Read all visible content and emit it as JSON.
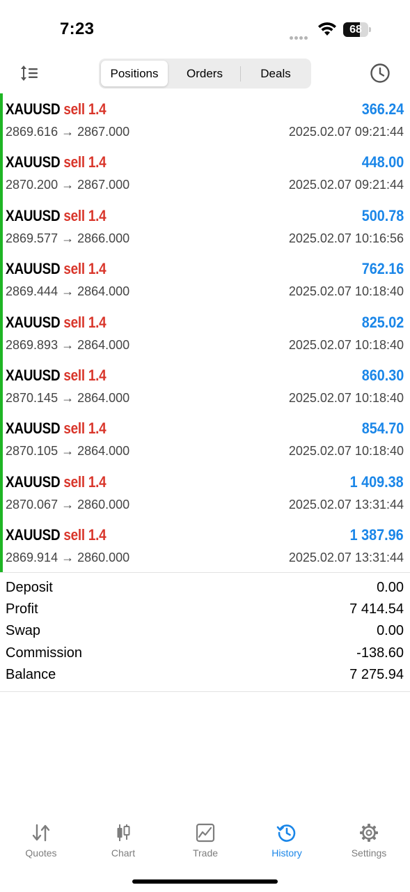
{
  "status_bar": {
    "time": "7:23",
    "battery": "68",
    "battery_level": 0.68
  },
  "toolbar": {
    "segments": [
      "Positions",
      "Orders",
      "Deals"
    ],
    "active_segment": "Positions",
    "left_icon": "sort-icon",
    "right_icon": "clock-icon"
  },
  "colors": {
    "profit": "#1a86e8",
    "sell": "#d9362b",
    "accent_bar": "#1fb524",
    "active_tab": "#1a86e8"
  },
  "positions": [
    {
      "symbol": "XAUUSD",
      "side": "sell 1.4",
      "profit": "366.24",
      "prices": "2869.616 → 2867.000",
      "time": "2025.02.07 09:21:44"
    },
    {
      "symbol": "XAUUSD",
      "side": "sell 1.4",
      "profit": "448.00",
      "prices": "2870.200 → 2867.000",
      "time": "2025.02.07 09:21:44"
    },
    {
      "symbol": "XAUUSD",
      "side": "sell 1.4",
      "profit": "500.78",
      "prices": "2869.577 → 2866.000",
      "time": "2025.02.07 10:16:56"
    },
    {
      "symbol": "XAUUSD",
      "side": "sell 1.4",
      "profit": "762.16",
      "prices": "2869.444 → 2864.000",
      "time": "2025.02.07 10:18:40"
    },
    {
      "symbol": "XAUUSD",
      "side": "sell 1.4",
      "profit": "825.02",
      "prices": "2869.893 → 2864.000",
      "time": "2025.02.07 10:18:40"
    },
    {
      "symbol": "XAUUSD",
      "side": "sell 1.4",
      "profit": "860.30",
      "prices": "2870.145 → 2864.000",
      "time": "2025.02.07 10:18:40"
    },
    {
      "symbol": "XAUUSD",
      "side": "sell 1.4",
      "profit": "854.70",
      "prices": "2870.105 → 2864.000",
      "time": "2025.02.07 10:18:40"
    },
    {
      "symbol": "XAUUSD",
      "side": "sell 1.4",
      "profit": "1 409.38",
      "prices": "2870.067 → 2860.000",
      "time": "2025.02.07 13:31:44"
    },
    {
      "symbol": "XAUUSD",
      "side": "sell 1.4",
      "profit": "1 387.96",
      "prices": "2869.914 → 2860.000",
      "time": "2025.02.07 13:31:44"
    }
  ],
  "summary": [
    {
      "label": "Deposit",
      "value": "0.00"
    },
    {
      "label": "Profit",
      "value": "7 414.54"
    },
    {
      "label": "Swap",
      "value": "0.00"
    },
    {
      "label": "Commission",
      "value": "-138.60"
    },
    {
      "label": "Balance",
      "value": "7 275.94"
    }
  ],
  "tabbar": {
    "tabs": [
      {
        "label": "Quotes",
        "icon": "quotes-arrows-icon"
      },
      {
        "label": "Chart",
        "icon": "candlestick-icon"
      },
      {
        "label": "Trade",
        "icon": "trade-chart-icon"
      },
      {
        "label": "History",
        "icon": "history-clock-icon"
      },
      {
        "label": "Settings",
        "icon": "gear-icon"
      }
    ],
    "active": "History"
  }
}
